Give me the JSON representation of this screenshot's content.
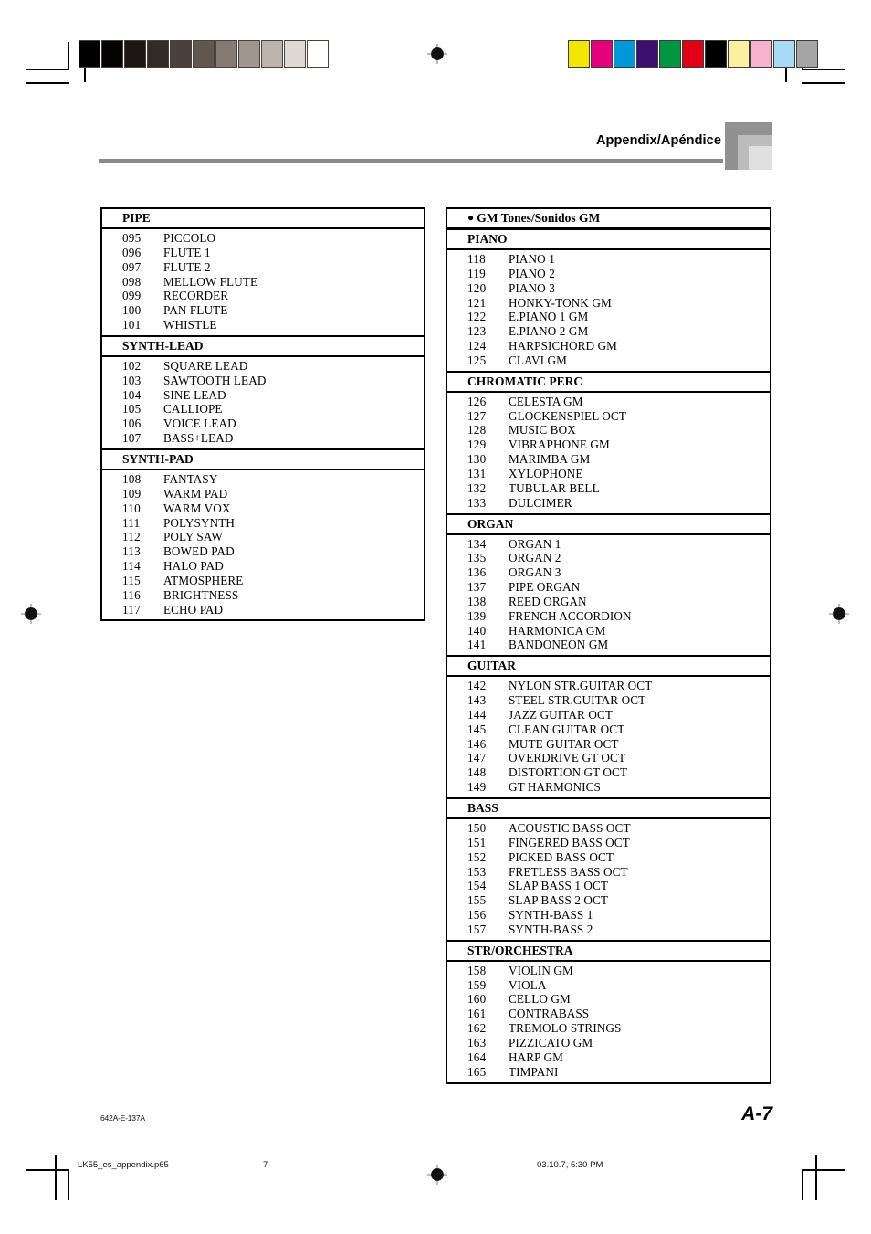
{
  "header": {
    "title": "Appendix/Apéndice"
  },
  "left_table": {
    "sections": [
      {
        "heading": "PIPE",
        "rows": [
          {
            "num": "095",
            "name": "PICCOLO"
          },
          {
            "num": "096",
            "name": "FLUTE 1"
          },
          {
            "num": "097",
            "name": "FLUTE 2"
          },
          {
            "num": "098",
            "name": "MELLOW FLUTE"
          },
          {
            "num": "099",
            "name": "RECORDER"
          },
          {
            "num": "100",
            "name": "PAN FLUTE"
          },
          {
            "num": "101",
            "name": "WHISTLE"
          }
        ]
      },
      {
        "heading": "SYNTH-LEAD",
        "rows": [
          {
            "num": "102",
            "name": "SQUARE LEAD"
          },
          {
            "num": "103",
            "name": "SAWTOOTH LEAD"
          },
          {
            "num": "104",
            "name": "SINE LEAD"
          },
          {
            "num": "105",
            "name": "CALLIOPE"
          },
          {
            "num": "106",
            "name": "VOICE LEAD"
          },
          {
            "num": "107",
            "name": "BASS+LEAD"
          }
        ]
      },
      {
        "heading": "SYNTH-PAD",
        "rows": [
          {
            "num": "108",
            "name": "FANTASY"
          },
          {
            "num": "109",
            "name": "WARM PAD"
          },
          {
            "num": "110",
            "name": "WARM VOX"
          },
          {
            "num": "111",
            "name": "POLYSYNTH"
          },
          {
            "num": "112",
            "name": "POLY SAW"
          },
          {
            "num": "113",
            "name": "BOWED PAD"
          },
          {
            "num": "114",
            "name": "HALO PAD"
          },
          {
            "num": "115",
            "name": "ATMOSPHERE"
          },
          {
            "num": "116",
            "name": "BRIGHTNESS"
          },
          {
            "num": "117",
            "name": "ECHO PAD"
          }
        ]
      }
    ]
  },
  "right_table": {
    "bullet": "●",
    "title": "GM Tones/Sonidos GM",
    "sections": [
      {
        "heading": "PIANO",
        "rows": [
          {
            "num": "118",
            "name": "PIANO 1"
          },
          {
            "num": "119",
            "name": "PIANO 2"
          },
          {
            "num": "120",
            "name": "PIANO 3"
          },
          {
            "num": "121",
            "name": "HONKY-TONK GM"
          },
          {
            "num": "122",
            "name": "E.PIANO 1 GM"
          },
          {
            "num": "123",
            "name": "E.PIANO 2 GM"
          },
          {
            "num": "124",
            "name": "HARPSICHORD GM"
          },
          {
            "num": "125",
            "name": "CLAVI GM"
          }
        ]
      },
      {
        "heading": "CHROMATIC PERC",
        "rows": [
          {
            "num": "126",
            "name": "CELESTA GM"
          },
          {
            "num": "127",
            "name": "GLOCKENSPIEL OCT"
          },
          {
            "num": "128",
            "name": "MUSIC BOX"
          },
          {
            "num": "129",
            "name": "VIBRAPHONE GM"
          },
          {
            "num": "130",
            "name": "MARIMBA GM"
          },
          {
            "num": "131",
            "name": "XYLOPHONE"
          },
          {
            "num": "132",
            "name": "TUBULAR BELL"
          },
          {
            "num": "133",
            "name": "DULCIMER"
          }
        ]
      },
      {
        "heading": "ORGAN",
        "rows": [
          {
            "num": "134",
            "name": "ORGAN 1"
          },
          {
            "num": "135",
            "name": "ORGAN 2"
          },
          {
            "num": "136",
            "name": "ORGAN 3"
          },
          {
            "num": "137",
            "name": "PIPE ORGAN"
          },
          {
            "num": "138",
            "name": "REED ORGAN"
          },
          {
            "num": "139",
            "name": "FRENCH ACCORDION"
          },
          {
            "num": "140",
            "name": "HARMONICA GM"
          },
          {
            "num": "141",
            "name": "BANDONEON GM"
          }
        ]
      },
      {
        "heading": "GUITAR",
        "rows": [
          {
            "num": "142",
            "name": "NYLON STR.GUITAR OCT"
          },
          {
            "num": "143",
            "name": "STEEL STR.GUITAR OCT"
          },
          {
            "num": "144",
            "name": "JAZZ GUITAR OCT"
          },
          {
            "num": "145",
            "name": "CLEAN GUITAR OCT"
          },
          {
            "num": "146",
            "name": "MUTE GUITAR OCT"
          },
          {
            "num": "147",
            "name": "OVERDRIVE GT OCT"
          },
          {
            "num": "148",
            "name": "DISTORTION GT OCT"
          },
          {
            "num": "149",
            "name": "GT HARMONICS"
          }
        ]
      },
      {
        "heading": "BASS",
        "rows": [
          {
            "num": "150",
            "name": "ACOUSTIC BASS OCT"
          },
          {
            "num": "151",
            "name": "FINGERED BASS OCT"
          },
          {
            "num": "152",
            "name": "PICKED BASS OCT"
          },
          {
            "num": "153",
            "name": "FRETLESS BASS OCT"
          },
          {
            "num": "154",
            "name": "SLAP BASS 1 OCT"
          },
          {
            "num": "155",
            "name": "SLAP BASS 2 OCT"
          },
          {
            "num": "156",
            "name": "SYNTH-BASS 1"
          },
          {
            "num": "157",
            "name": "SYNTH-BASS 2"
          }
        ]
      },
      {
        "heading": "STR/ORCHESTRA",
        "rows": [
          {
            "num": "158",
            "name": "VIOLIN GM"
          },
          {
            "num": "159",
            "name": "VIOLA"
          },
          {
            "num": "160",
            "name": "CELLO GM"
          },
          {
            "num": "161",
            "name": "CONTRABASS"
          },
          {
            "num": "162",
            "name": "TREMOLO STRINGS"
          },
          {
            "num": "163",
            "name": "PIZZICATO GM"
          },
          {
            "num": "164",
            "name": "HARP GM"
          },
          {
            "num": "165",
            "name": "TIMPANI"
          }
        ]
      }
    ]
  },
  "footer": {
    "doc_code": "642A-E-137A",
    "page_label": "A-7",
    "print_filename": "LK55_es_appendix.p65",
    "print_pagenum": "7",
    "print_datetime": "03.10.7, 5:30 PM"
  },
  "calibration": {
    "grayscale_swatches": [
      "#000000",
      "#050202",
      "#1c1614",
      "#332b27",
      "#4a403c",
      "#615650",
      "#857a74",
      "#a0968f",
      "#bcb3ac",
      "#ded9d4",
      "#ffffff"
    ],
    "color_swatches": [
      "#f2e500",
      "#e5007d",
      "#0098d8",
      "#3d0f70",
      "#009540",
      "#e30016",
      "#000000",
      "#faf0a0",
      "#f7b2ce",
      "#a8daf5",
      "#a5a5a5"
    ]
  }
}
